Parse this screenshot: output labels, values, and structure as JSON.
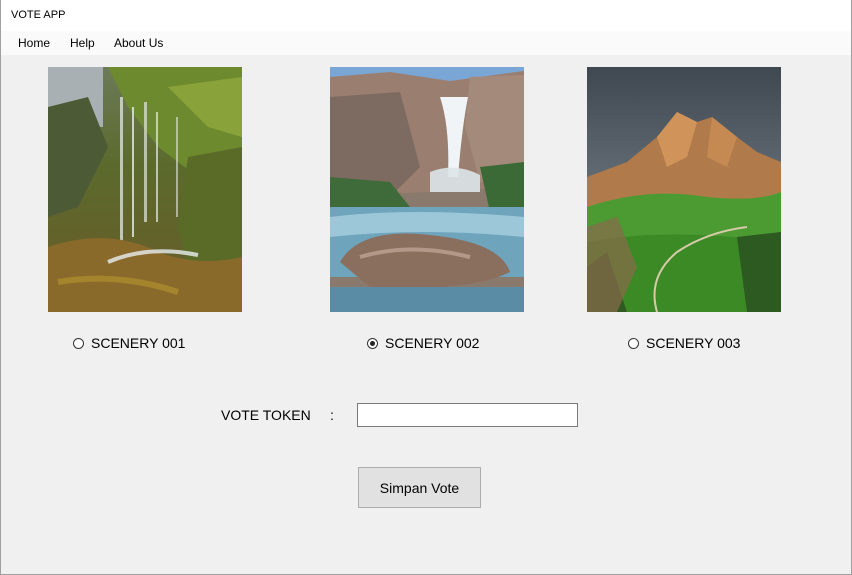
{
  "window": {
    "title": "VOTE APP"
  },
  "menu": {
    "items": [
      "Home",
      "Help",
      "About Us"
    ]
  },
  "options": [
    {
      "label": "SCENERY 001",
      "selected": false,
      "image": "waterfall-moss-photo"
    },
    {
      "label": "SCENERY 002",
      "selected": true,
      "image": "waterfall-canyon-photo"
    },
    {
      "label": "SCENERY 003",
      "selected": false,
      "image": "mountain-meadow-photo"
    }
  ],
  "form": {
    "token_label": "VOTE TOKEN",
    "colon": ":",
    "token_value": "",
    "token_placeholder": "",
    "save_label": "Simpan Vote"
  }
}
